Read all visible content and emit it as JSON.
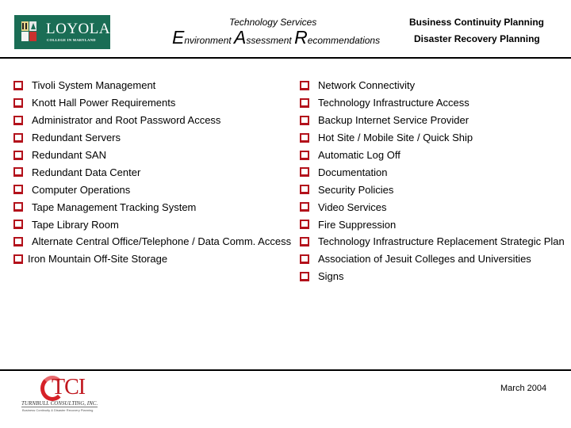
{
  "header": {
    "logo_left": {
      "name": "LOYOLA",
      "subtitle": "COLLEGE IN MARYLAND",
      "brand_color": "#1a6d55"
    },
    "department": "Technology Services",
    "title": {
      "word1_initial": "E",
      "word1_rest": "nvironment ",
      "word2_initial": "A",
      "word2_rest": "ssessment ",
      "word3_initial": "R",
      "word3_rest": "ecommendations"
    },
    "right_line1": "Business Continuity Planning",
    "right_line2": "Disaster Recovery Planning"
  },
  "bullet_icon": "checkbox-square-icon",
  "bullet_color": "#b3111b",
  "left_items": [
    "Tivoli System Management",
    "Knott Hall Power Requirements",
    "Administrator and Root Password Access",
    "Redundant Servers",
    "Redundant SAN",
    "Redundant Data Center",
    "Computer Operations",
    "Tape Management Tracking System",
    "Tape Library Room",
    "Alternate Central Office/Telephone / Data Comm. Access",
    "Iron Mountain Off-Site Storage"
  ],
  "right_items": [
    "Network Connectivity",
    "Technology Infrastructure Access",
    "Backup Internet Service Provider",
    "Hot Site / Mobile Site / Quick Ship",
    "Automatic Log Off",
    "Documentation",
    "Security Policies",
    "Video Services",
    "Fire Suppression",
    "Technology Infrastructure Replacement Strategic Plan",
    "Association of Jesuit Colleges and Universities",
    "Signs"
  ],
  "footer": {
    "logo": {
      "mark": "TCI",
      "company": "TURNBULL CONSULTING, INC.",
      "tagline": "Business Continuity & Disaster Recovery Planning",
      "brand_color": "#c0161d"
    },
    "date": "March 2004"
  }
}
